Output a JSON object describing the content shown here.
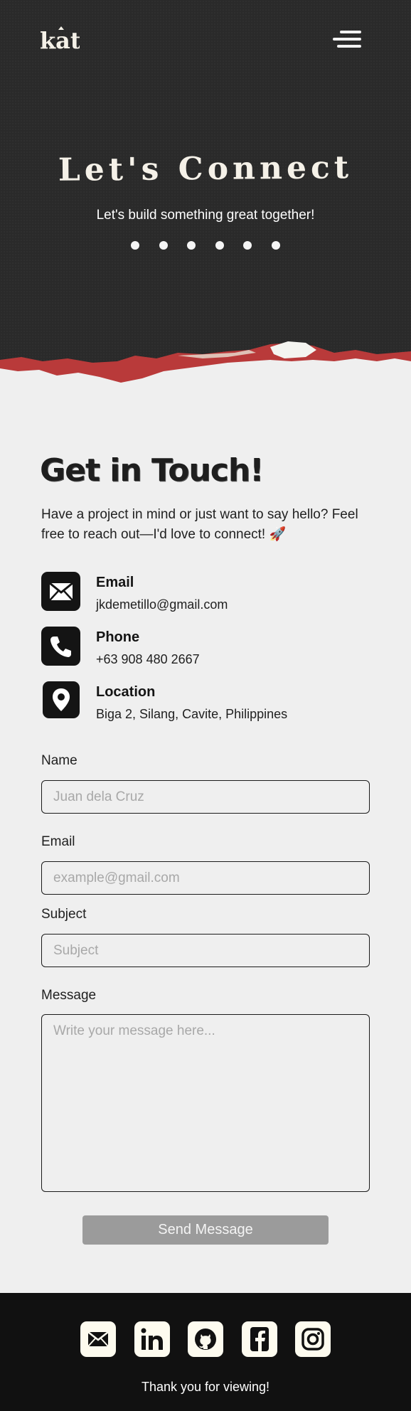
{
  "header": {
    "logo_text": "kat",
    "menu_icon": "hamburger-menu-icon"
  },
  "hero": {
    "title": "Let's Connect",
    "subtitle": "Let's build something great together!",
    "dot_count": 6
  },
  "contact": {
    "title": "Get in Touch!",
    "intro": "Have a project in mind or just want to say hello? Feel free to reach out—I'd love to connect! 🚀",
    "items": [
      {
        "icon": "envelope-icon",
        "label": "Email",
        "value": "jkdemetillo@gmail.com"
      },
      {
        "icon": "phone-icon",
        "label": "Phone",
        "value": "+63 908 480 2667"
      },
      {
        "icon": "location-pin-icon",
        "label": "Location",
        "value": "Biga 2, Silang, Cavite, Philippines"
      }
    ]
  },
  "form": {
    "name_label": "Name",
    "name_placeholder": "Juan dela Cruz",
    "email_label": "Email",
    "email_placeholder": "example@gmail.com",
    "subject_label": "Subject",
    "subject_placeholder": "Subject",
    "message_label": "Message",
    "message_placeholder": "Write your message here...",
    "send_label": "Send Message"
  },
  "footer": {
    "socials": [
      "email-icon",
      "linkedin-icon",
      "github-icon",
      "facebook-icon",
      "instagram-icon"
    ],
    "thanks": "Thank you for viewing!"
  },
  "colors": {
    "hero_bg": "#2a2a2a",
    "tear_red": "#b93a3a",
    "page_bg": "#efefef",
    "footer_bg": "#111111",
    "button_bg": "#9b9b9b"
  }
}
